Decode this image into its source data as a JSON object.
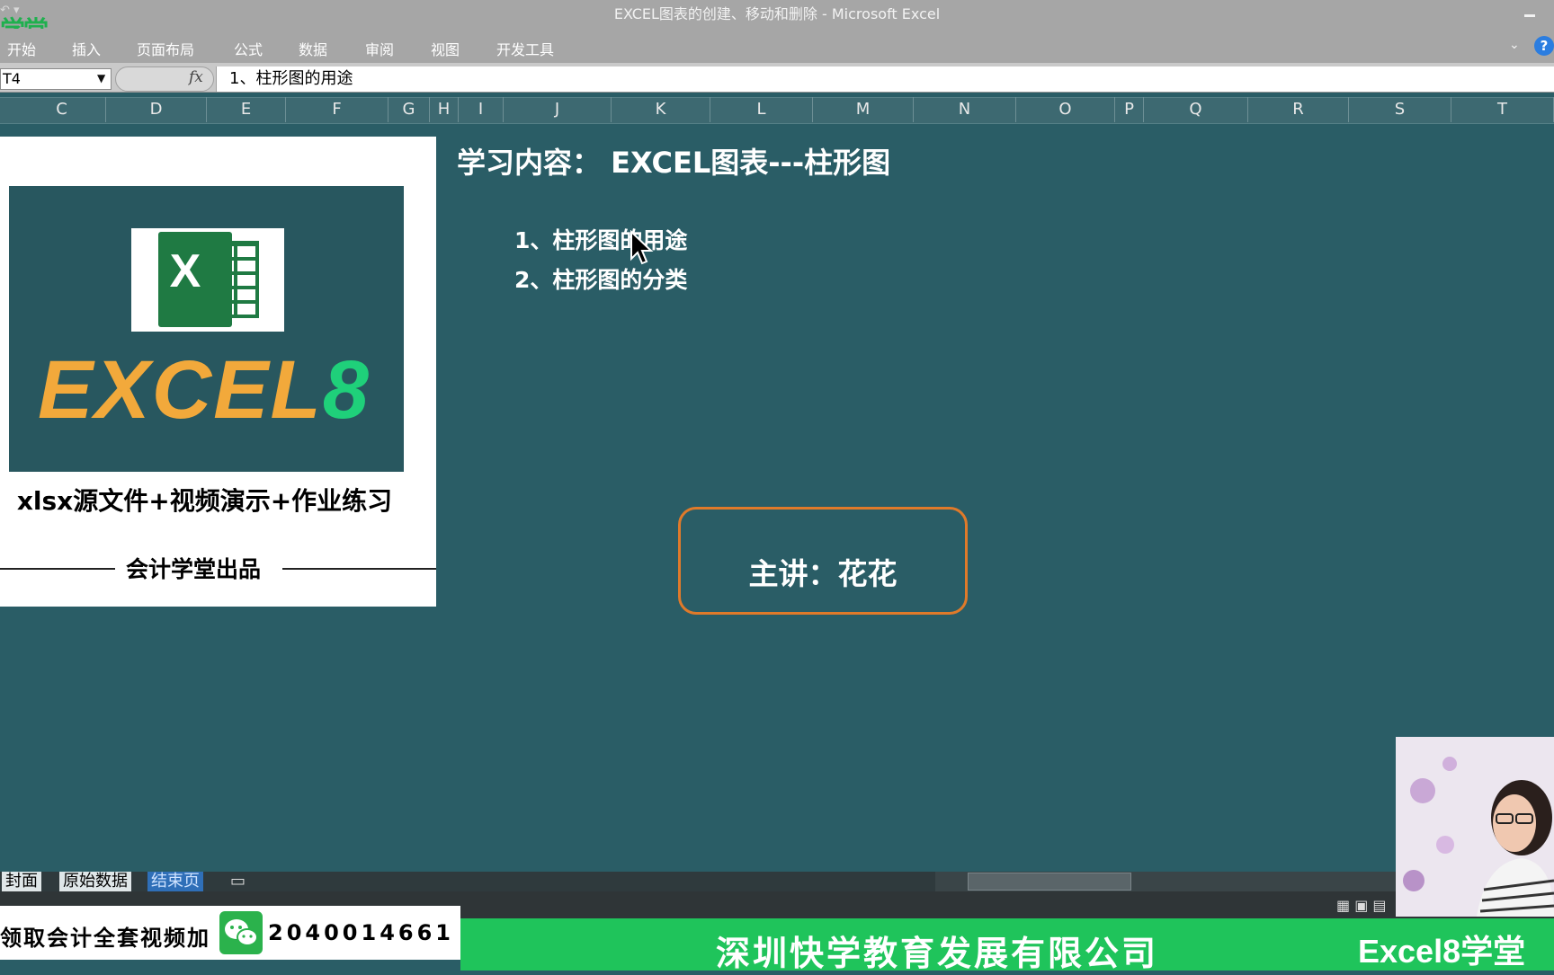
{
  "window": {
    "title": "EXCEL图表的创建、移动和删除 - Microsoft Excel",
    "logo_text": "学堂",
    "minimize_icon": "minimize-icon",
    "help_icon": "help-icon"
  },
  "ribbon": {
    "tabs": [
      "开始",
      "插入",
      "页面布局",
      "公式",
      "数据",
      "审阅",
      "视图",
      "开发工具"
    ]
  },
  "formula_bar": {
    "name_box": "T4",
    "fx_label": "fx",
    "content": "1、柱形图的用途"
  },
  "columns": [
    "C",
    "D",
    "E",
    "F",
    "G",
    "H",
    "I",
    "J",
    "K",
    "L",
    "M",
    "N",
    "O",
    "P",
    "Q",
    "R",
    "S",
    "T"
  ],
  "cover_card": {
    "icon_letter": "X",
    "brand_part1": "EXCEL",
    "brand_part2": "8",
    "tagline": "xlsx源文件+视频演示+作业练习",
    "producer": "会计学堂出品",
    "brand_colors": {
      "orange": "#f2a93b",
      "green": "#1fd07a",
      "banner": "#28575f"
    }
  },
  "slide": {
    "title": "学习内容： EXCEL图表---柱形图",
    "outline": [
      "1、柱形图的用途",
      "2、柱形图的分类"
    ],
    "speaker": "主讲：花花",
    "accent_border": "#e07a2a",
    "background": "#2a5d66"
  },
  "sheet_tabs": [
    "封面",
    "原始数据",
    "结束页"
  ],
  "promo": {
    "left_text": "领取会计全套视频加",
    "wechat_icon": "wechat-icon",
    "number": "2040014661",
    "company": "深圳快学教育发展有限公司",
    "brand_tag": "Excel8学堂",
    "bar_color": "#1fc45b"
  }
}
